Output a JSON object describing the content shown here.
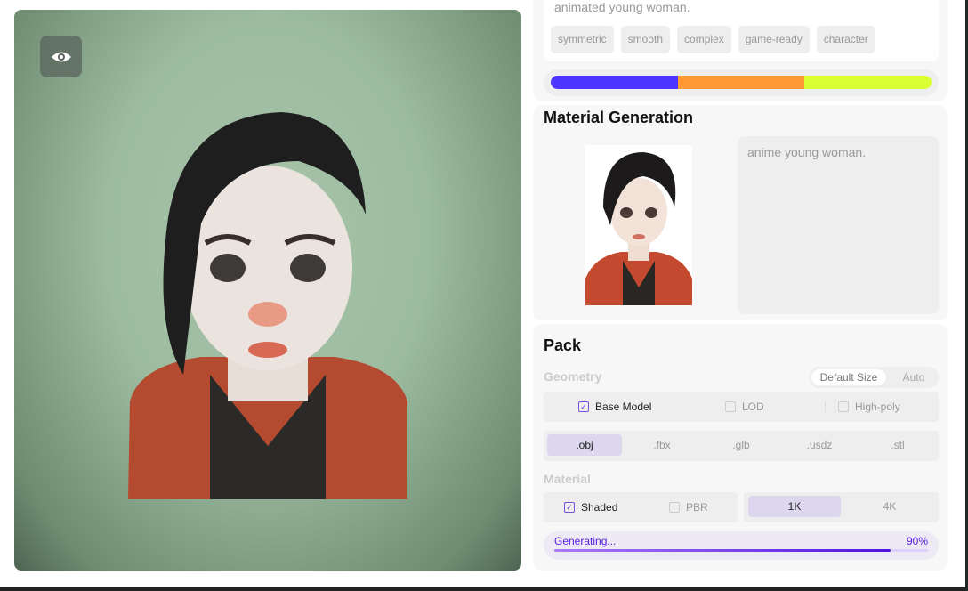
{
  "viewer": {
    "toggle_icon": "eye-icon",
    "background_color": "#9cbb9f"
  },
  "prompt": {
    "text": "animated young woman.",
    "tags": [
      "symmetric",
      "smooth",
      "complex",
      "game-ready",
      "character"
    ]
  },
  "segment_bar": {
    "segments": [
      {
        "color": "#4b35ff",
        "fraction": 0.333
      },
      {
        "color": "#ff9933",
        "fraction": 0.333
      },
      {
        "color": "#d9ff33",
        "fraction": 0.334
      }
    ]
  },
  "material": {
    "title": "Material Generation",
    "prompt_text": "anime young woman."
  },
  "pack": {
    "title": "Pack",
    "geometry_label": "Geometry",
    "size_options": [
      "Default Size",
      "Auto"
    ],
    "size_selected": "Default Size",
    "geometry_options": [
      {
        "label": "Base Model",
        "checked": true
      },
      {
        "label": "LOD",
        "checked": false
      },
      {
        "label": "High-poly",
        "checked": false
      }
    ],
    "formats": [
      ".obj",
      ".fbx",
      ".glb",
      ".usdz",
      ".stl"
    ],
    "format_selected": ".obj",
    "material_label": "Material",
    "material_options": [
      {
        "label": "Shaded",
        "checked": true
      },
      {
        "label": "PBR",
        "checked": false
      }
    ],
    "resolutions": [
      "1K",
      "4K"
    ],
    "resolution_selected": "1K",
    "status": "Generating...",
    "progress_text": "90%",
    "progress": 0.9,
    "accent": "#5a1ee0"
  }
}
